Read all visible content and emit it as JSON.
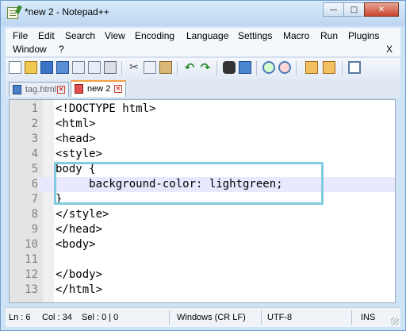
{
  "window": {
    "title": "*new 2 - Notepad++"
  },
  "menu": {
    "items": [
      "File",
      "Edit",
      "Search",
      "View",
      "Encoding",
      "Language",
      "Settings",
      "Macro",
      "Run",
      "Plugins",
      "Window",
      "?"
    ],
    "close_label": "X"
  },
  "tabs": [
    {
      "label": "tag.html",
      "active": false
    },
    {
      "label": "new 2",
      "active": true
    }
  ],
  "editor": {
    "current_line": 6,
    "lines": [
      {
        "num": "1",
        "code": "<!DOCTYPE html>"
      },
      {
        "num": "2",
        "code": "<html>"
      },
      {
        "num": "3",
        "code": "<head>"
      },
      {
        "num": "4",
        "code": "<style>"
      },
      {
        "num": "5",
        "code": "body {"
      },
      {
        "num": "6",
        "code": "     background-color: lightgreen;"
      },
      {
        "num": "7",
        "code": "}"
      },
      {
        "num": "8",
        "code": "</style>"
      },
      {
        "num": "9",
        "code": "</head>"
      },
      {
        "num": "10",
        "code": "<body>"
      },
      {
        "num": "11",
        "code": ""
      },
      {
        "num": "12",
        "code": "</body>"
      },
      {
        "num": "13",
        "code": "</html>"
      }
    ]
  },
  "status": {
    "ln": "Ln : 6",
    "col": "Col : 34",
    "sel": "Sel : 0 | 0",
    "eol": "Windows (CR LF)",
    "encoding": "UTF-8",
    "mode": "INS"
  },
  "icons": {
    "toolbar": [
      "new-file-icon",
      "open-file-icon",
      "save-icon",
      "save-all-icon",
      "close-icon",
      "close-all-icon",
      "print-icon",
      "cut-icon",
      "copy-icon",
      "paste-icon",
      "undo-icon",
      "redo-icon",
      "find-icon",
      "replace-icon",
      "zoom-in-icon",
      "zoom-out-icon",
      "sync-v-icon",
      "sync-h-icon",
      "word-wrap-icon"
    ]
  },
  "colors": {
    "highlight_box": "#80cce0",
    "current_line": "#e8e8ff",
    "active_tab_accent": "#f0a040"
  }
}
